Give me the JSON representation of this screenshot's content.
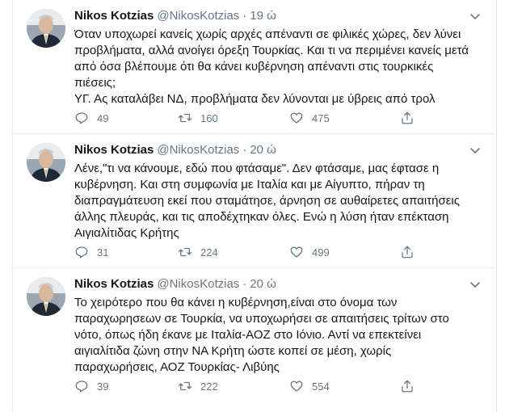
{
  "colors": {
    "text": "#14171a",
    "muted": "#657786",
    "border": "#e6ecf0"
  },
  "icons": {
    "reply": "reply-icon",
    "retweet": "retweet-icon",
    "like": "heart-icon",
    "share": "share-icon",
    "menu": "chevron-down-icon"
  },
  "tweets": [
    {
      "name": "Nikos Kotzias",
      "handle": "@NikosKotzias",
      "separator": "·",
      "time": "19 ώ",
      "text": "Όταν υποχωρεί κανείς χωρίς αρχές απέναντι σε φιλικές χώρες, δεν λύνει\nπροβλήματα, αλλά ανοίγει όρεξη Τουρκίας. Και τι να περιμένει κανείς μετά\nαπό όσα βλέπουμε ότι θα κάνει κυβέρνηση απέναντι στις τουρκικές\nπιέσεις;\nΥΓ. Ας καταλάβει ΝΔ, προβλήματα δεν λύνονται με ύβρεις από τρολ",
      "replies": "49",
      "retweets": "160",
      "likes": "475"
    },
    {
      "name": "Nikos Kotzias",
      "handle": "@NikosKotzias",
      "separator": "·",
      "time": "20 ώ",
      "text": "Λένε,\"τι να κάνουμε, εδώ που φτάσαμε\". Δεν φτάσαμε, μας έφτασε η\nκυβέρνηση. Και στη συμφωνία με Ιταλία και με Αίγυπτο, πήραν τη\nδιαπραγμάτευση εκεί που σταμάτησε, άρνηση σε αυθαίρετες απαιτήσεις\nάλλης πλευράς, και τις αποδέχτηκαν όλες. Ενώ η λύση ήταν επέκταση\nΑιγιαλίτιδας Κρήτης",
      "replies": "31",
      "retweets": "224",
      "likes": "499"
    },
    {
      "name": "Nikos Kotzias",
      "handle": "@NikosKotzias",
      "separator": "·",
      "time": "20 ώ",
      "text": "Το χειρότερο που θα κάνει η κυβέρνηση,είναι στο όνομα των\nπαραχωρησεων σε Τουρκία, να υποχωρήσει σε απαιτήσεις τρίτων στο\nνότο, όπως ήδη έκανε με Ιταλία-ΑΟΖ στο Ιόνιο. Αντί να επεκτείνει\nαιγιαλίτιδα ζώνη στην ΝΑ Κρήτη ώστε κοπεί σε μέση, χωρίς\nπαραχωρήσεις, ΑΟΖ Τουρκίας- Λιβύης",
      "replies": "39",
      "retweets": "222",
      "likes": "554"
    }
  ]
}
